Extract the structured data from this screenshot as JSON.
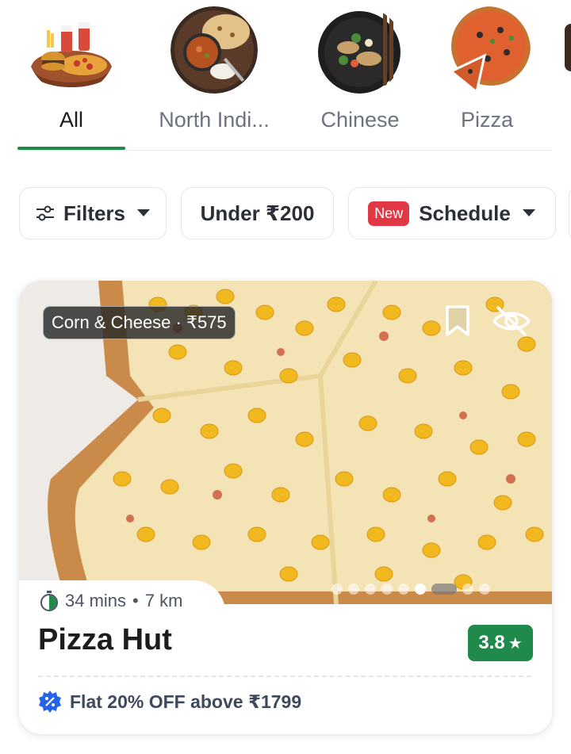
{
  "categories": [
    {
      "label": "All",
      "icon": "all-food-icon",
      "active": true
    },
    {
      "label": "North Indi...",
      "icon": "north-indian-food-icon",
      "active": false
    },
    {
      "label": "Chinese",
      "icon": "chinese-food-icon",
      "active": false
    },
    {
      "label": "Pizza",
      "icon": "pizza-food-icon",
      "active": false
    }
  ],
  "filters": {
    "filters_label": "Filters",
    "under_label": "Under ₹200",
    "new_badge": "New",
    "schedule_label": "Schedule"
  },
  "restaurant": {
    "dish_tag": "Corn & Cheese · ₹575",
    "eta_time": "34 mins",
    "eta_distance": "7 km",
    "name": "Pizza Hut",
    "rating": "3.8",
    "offer": "Flat 20% OFF above ₹1799",
    "image_slides": 9,
    "active_slide": 6
  },
  "colors": {
    "accent_green": "#1f8a4c",
    "new_badge_red": "#e23744",
    "offer_blue": "#2563eb"
  }
}
